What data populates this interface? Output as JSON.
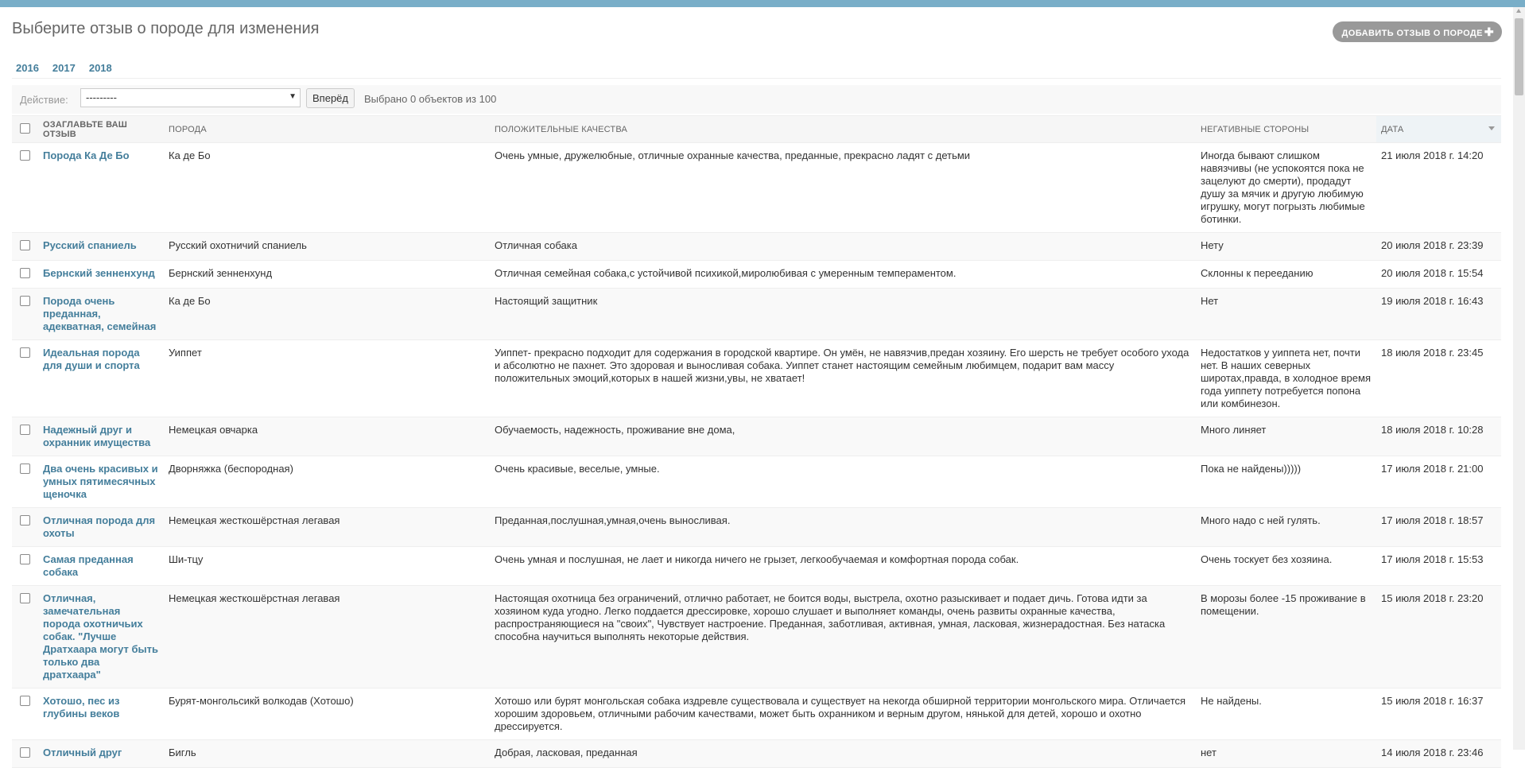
{
  "header": {
    "title": "Выберите отзыв о породе для изменения",
    "add_button": "Добавить отзыв о породе"
  },
  "date_hierarchy": [
    "2016",
    "2017",
    "2018"
  ],
  "actions": {
    "label": "Действие:",
    "selected": "---------",
    "go_button": "Вперёд",
    "counter": "Выбрано 0 объектов из 100"
  },
  "table": {
    "columns": [
      "Озаглавьте ваш отзыв",
      "Порода",
      "Положительные качества",
      "Негативные стороны",
      "Дата"
    ],
    "rows": [
      {
        "title": "Порода Ка Де Бо",
        "breed": "Ка де Бо",
        "positive": "Очень умные, дружелюбные, отличные охранные качества, преданные, прекрасно ладят с детьми",
        "negative": "Иногда бывают слишком навязчивы (не успокоятся пока не зацелуют до смерти), продадут душу за мячик и другую любимую игрушку, могут погрызть любимые ботинки.",
        "date": "21 июля 2018 г. 14:20"
      },
      {
        "title": "Русский спаниель",
        "breed": "Русский охотничий спаниель",
        "positive": "Отличная собака",
        "negative": "Нету",
        "date": "20 июля 2018 г. 23:39"
      },
      {
        "title": "Бернский зенненхунд",
        "breed": "Бернский зенненхунд",
        "positive": "Отличная семейная собака,с устойчивой психикой,миролюбивая с умеренным темпераментом.",
        "negative": "Склонны к перееданию",
        "date": "20 июля 2018 г. 15:54"
      },
      {
        "title": "Порода очень преданная, адекватная, семейная",
        "breed": "Ка де Бо",
        "positive": "Настоящий защитник",
        "negative": "Нет",
        "date": "19 июля 2018 г. 16:43"
      },
      {
        "title": "Идеальная порода для души и спорта",
        "breed": "Уиппет",
        "positive": "Уиппет- прекрасно подходит для содержания в городской квартире. Он умён, не навязчив,предан хозяину. Его шерсть не требует особого ухода и абсолютно не пахнет. Это здоровая и выносливая собака. Уиппет станет настоящим семейным любимцем, подарит вам массу положительных эмоций,которых в нашей жизни,увы, не хватает!",
        "negative": "Недостатков у уиппета нет, почти нет. В наших северных широтах,правда, в холодное время года уиппету потребуется попона или комбинезон.",
        "date": "18 июля 2018 г. 23:45"
      },
      {
        "title": "Надежный друг и охранник имущества",
        "breed": "Немецкая овчарка",
        "positive": "Обучаемость, надежность, проживание вне дома,",
        "negative": "Много линяет",
        "date": "18 июля 2018 г. 10:28"
      },
      {
        "title": "Два очень красивых и умных пятимесячных щеночка",
        "breed": "Дворняжка (беспородная)",
        "positive": "Очень красивые, веселые, умные.",
        "negative": "Пока не найдены)))))",
        "date": "17 июля 2018 г. 21:00"
      },
      {
        "title": "Отличная порода для охоты",
        "breed": "Немецкая жесткошёрстная легавая",
        "positive": "Преданная,послушная,умная,очень выносливая.",
        "negative": "Много надо с ней гулять.",
        "date": "17 июля 2018 г. 18:57"
      },
      {
        "title": "Самая преданная собака",
        "breed": "Ши-тцу",
        "positive": "Очень умная и послушная, не лает и никогда ничего не грызет, легкообучаемая и комфортная порода собак.",
        "negative": "Очень тоскует без хозяина.",
        "date": "17 июля 2018 г. 15:53"
      },
      {
        "title": "Отличная, замечательная порода охотничьих собак. \"Лучше Дратхаара могут быть только два дратхаара\"",
        "breed": "Немецкая жесткошёрстная легавая",
        "positive": "Настоящая охотница без ограничений, отлично работает, не боится воды, выстрела, охотно разыскивает и подает дичь. Готова идти за хозяином куда угодно. Легко поддается дрессировке, хорошо слушает и выполняет команды, очень развиты охранные качества, распространяющиеся на \"своих\", Чувствует настроение. Преданная, заботливая, активная, умная, ласковая, жизнерадостная. Без натаска способна научиться выполнять некоторые действия.",
        "negative": "В морозы более -15 проживание в помещении.",
        "date": "15 июля 2018 г. 23:20"
      },
      {
        "title": "Хотошо, пес из глубины веков",
        "breed": "Бурят-монгольсикй волкодав (Хотошо)",
        "positive": "Хотошо или бурят монгольская собака издревле существовала и существует на некогда обширной территории монгольского мира. Отличается хорошим здоровьем, отличными рабочим качествами, может быть охранником и верным другом, нянькой для детей, хорошо и охотно дрессируется.",
        "negative": "Не найдены.",
        "date": "15 июля 2018 г. 16:37"
      },
      {
        "title": "Отличный друг",
        "breed": "Бигль",
        "positive": "Добрая, ласковая, преданная",
        "negative": "нет",
        "date": "14 июля 2018 г. 23:46"
      }
    ]
  }
}
